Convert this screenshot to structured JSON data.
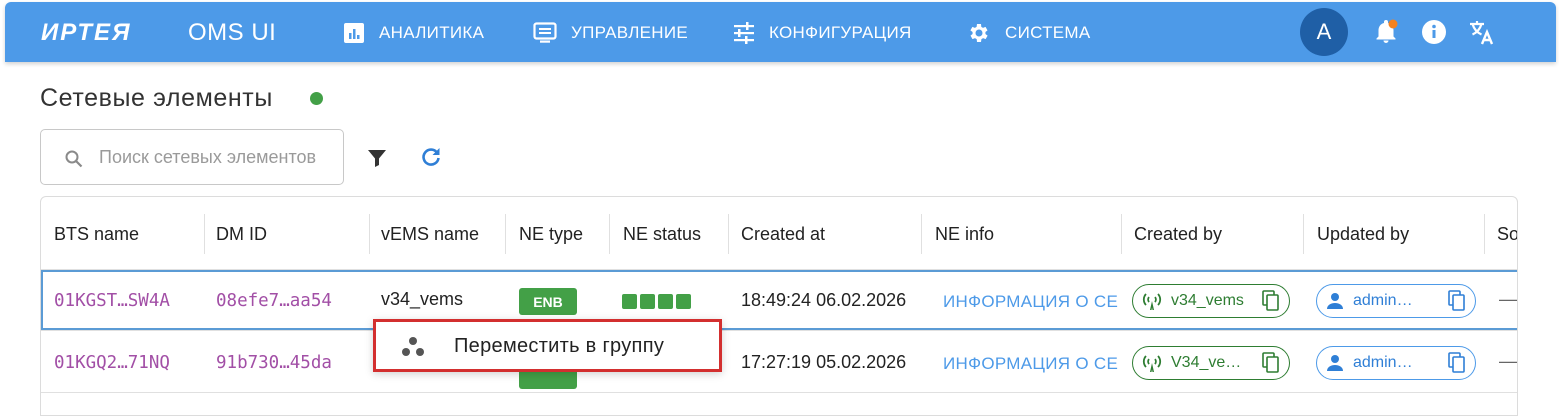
{
  "header": {
    "logo": "ИРТЕЯ",
    "app_name": "OMS UI",
    "nav": [
      {
        "label": "АНАЛИТИКА",
        "icon": "analytics-icon"
      },
      {
        "label": "УПРАВЛЕНИЕ",
        "icon": "management-icon"
      },
      {
        "label": "КОНФИГУРАЦИЯ",
        "icon": "tune-icon"
      },
      {
        "label": "СИСТЕМА",
        "icon": "gear-icon"
      }
    ],
    "avatar_letter": "A",
    "colors": {
      "bar": "#4d9ae8",
      "avatar": "#1f5fa6",
      "notification_dot": "#f4821f"
    }
  },
  "page": {
    "title": "Сетевые элементы",
    "status_color": "#43a047"
  },
  "search": {
    "placeholder": "Поиск сетевых элементов",
    "value": ""
  },
  "table": {
    "columns": [
      "BTS name",
      "DM ID",
      "vEMS name",
      "NE type",
      "NE status",
      "Created at",
      "NE info",
      "Created by",
      "Updated by",
      "So"
    ],
    "rows": [
      {
        "bts_name": "01KGST…SW4A",
        "dm_id": "08efe7…aa54",
        "vems_name": "v34_vems",
        "ne_type": "ENB",
        "created_at": "18:49:24 06.02.2026",
        "ne_info": "ИНФОРМАЦИЯ О СЕ",
        "created_by": "v34_vems",
        "updated_by": "admin…",
        "extra": "—"
      },
      {
        "bts_name": "01KGQ2…71NQ",
        "dm_id": "91b730…45da",
        "vems_name": "",
        "ne_type": "",
        "created_at": "17:27:19 05.02.2026",
        "ne_info": "ИНФОРМАЦИЯ О СЕ",
        "created_by": "V34_ve…",
        "updated_by": "admin…",
        "extra": "—"
      }
    ]
  },
  "context_menu": {
    "items": [
      {
        "label": "Переместить в группу",
        "icon": "group-move-icon"
      }
    ]
  }
}
